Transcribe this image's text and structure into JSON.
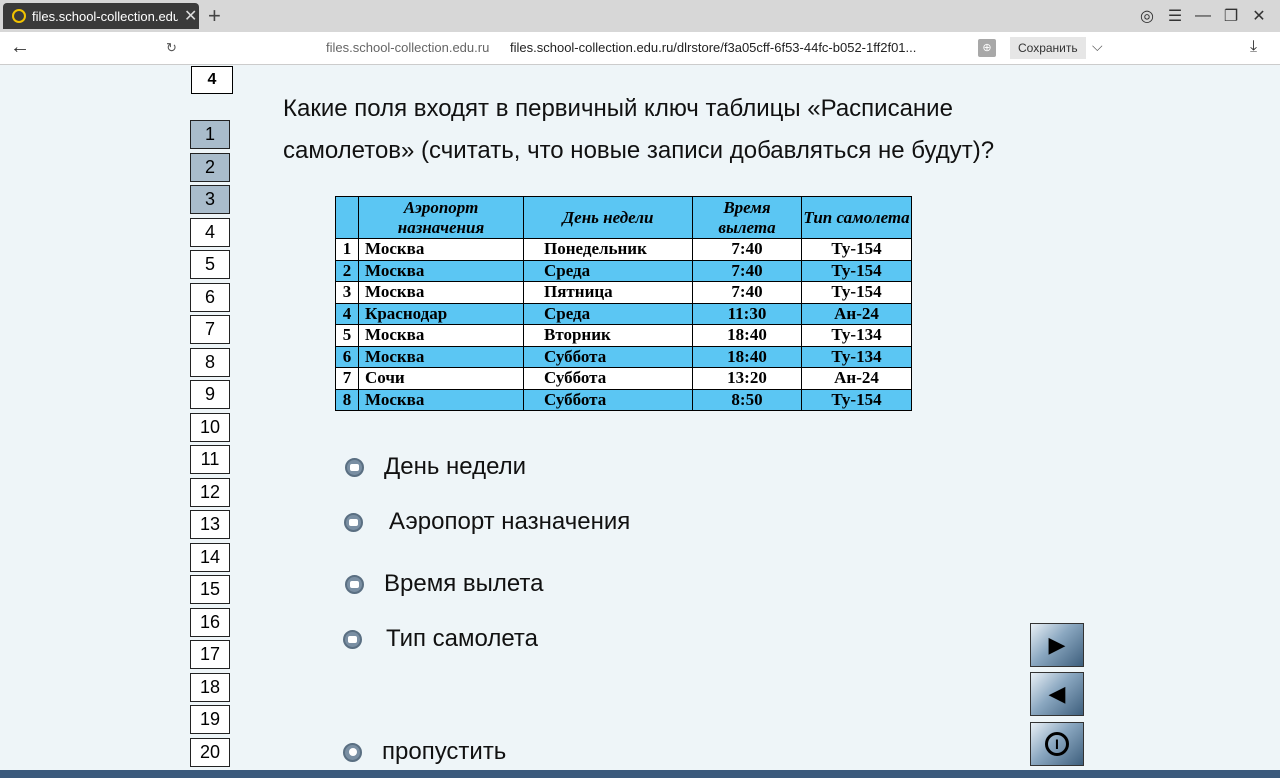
{
  "browser": {
    "tab_title": "files.school-collection.edu",
    "host": "files.school-collection.edu.ru",
    "url": "files.school-collection.edu.ru/dlrstore/f3a05cff-6f53-44fc-b052-1ff2f01...",
    "save_label": "Сохранить"
  },
  "current_question": "4",
  "question_numbers": [
    "1",
    "2",
    "3",
    "4",
    "5",
    "6",
    "7",
    "8",
    "9",
    "10",
    "11",
    "12",
    "13",
    "14",
    "15",
    "16",
    "17",
    "18",
    "19",
    "20"
  ],
  "question_text": "Какие поля входят в первичный ключ таблицы «Расписание самолетов» (считать, что новые записи добавляться не будут)?",
  "table": {
    "headers": [
      "",
      "Аэропорт назначения",
      "День недели",
      "Время вылета",
      "Тип самолета"
    ],
    "rows": [
      [
        "1",
        "Москва",
        "Понедельник",
        "7:40",
        "Ту-154"
      ],
      [
        "2",
        "Москва",
        "Среда",
        "7:40",
        "Ту-154"
      ],
      [
        "3",
        "Москва",
        "Пятница",
        "7:40",
        "Ту-154"
      ],
      [
        "4",
        "Краснодар",
        "Среда",
        "11:30",
        "Ан-24"
      ],
      [
        "5",
        "Москва",
        "Вторник",
        "18:40",
        "Ту-134"
      ],
      [
        "6",
        "Москва",
        "Суббота",
        "18:40",
        "Ту-134"
      ],
      [
        "7",
        "Сочи",
        "Суббота",
        "13:20",
        "Ан-24"
      ],
      [
        "8",
        "Москва",
        "Суббота",
        "8:50",
        "Ту-154"
      ]
    ]
  },
  "options": [
    "День недели",
    "Аэропорт назначения",
    "Время вылета",
    "Тип самолета"
  ],
  "skip_label": "пропустить",
  "colors": {
    "table_highlight": "#5bc6f3",
    "answered_box": "#a9bccb"
  }
}
